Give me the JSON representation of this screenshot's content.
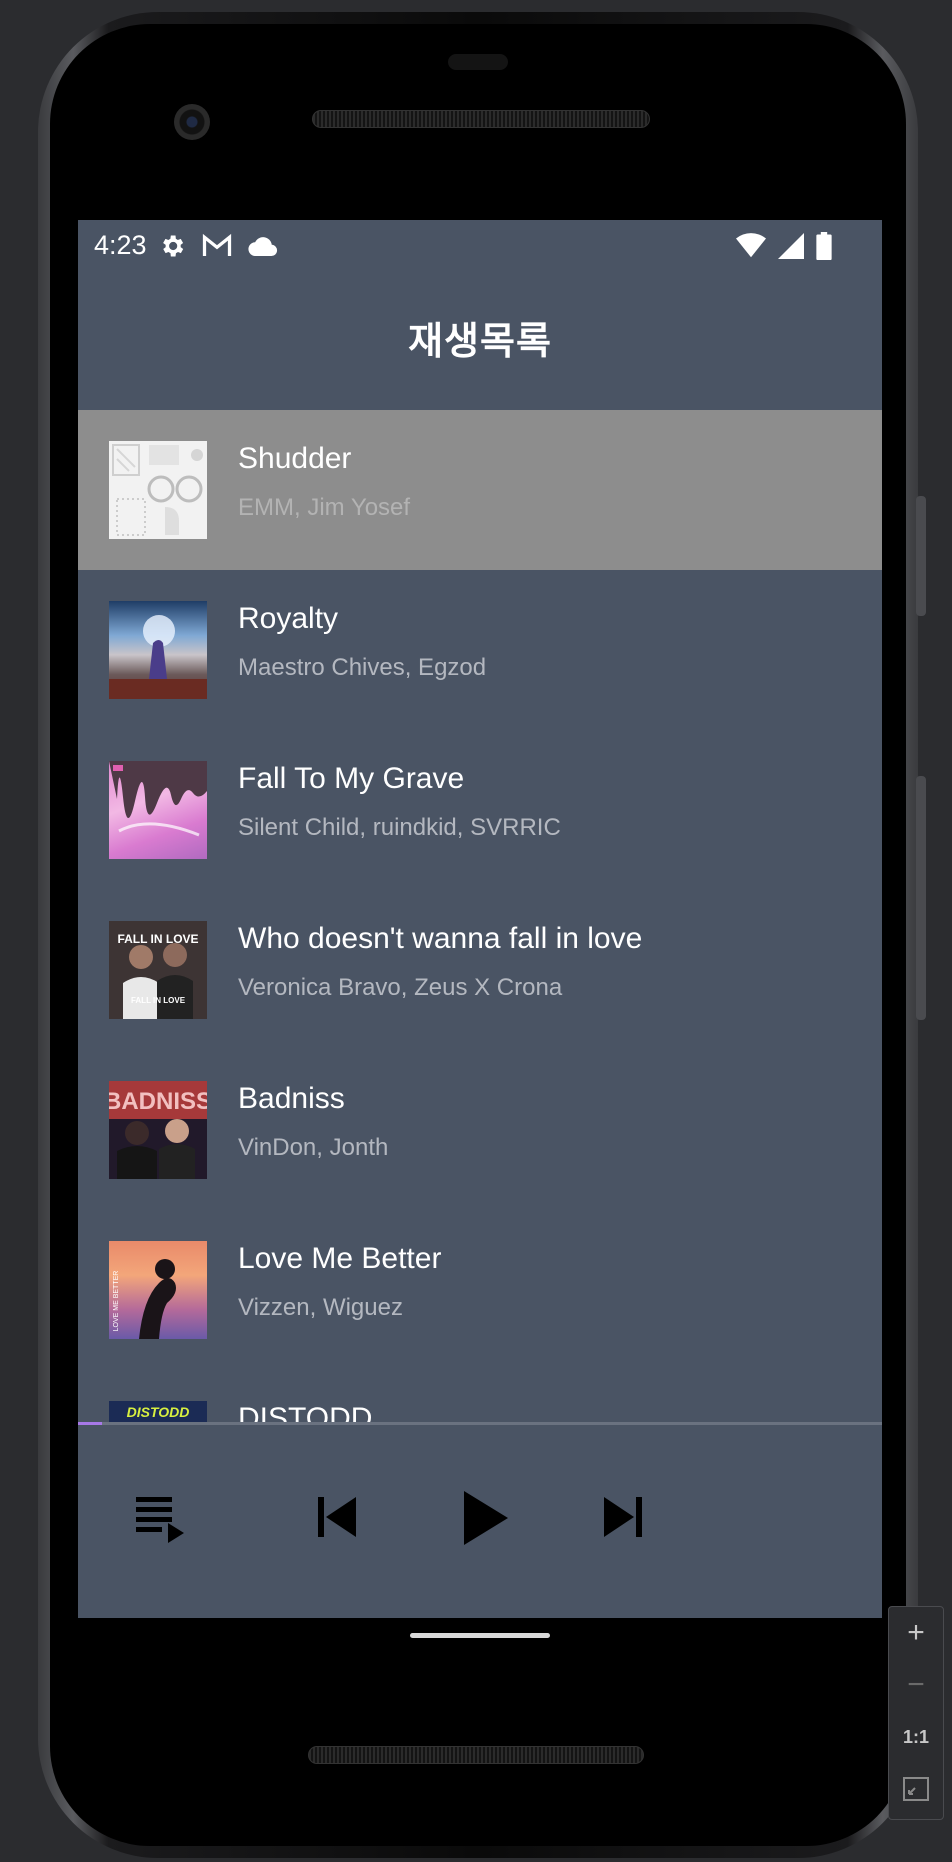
{
  "status_bar": {
    "time": "4:23",
    "left_icons": [
      "gear-icon",
      "gmail-icon",
      "cloud-icon"
    ],
    "right_icons": [
      "wifi-icon",
      "signal-icon",
      "battery-icon"
    ]
  },
  "header": {
    "title": "재생목록"
  },
  "playlist": {
    "items": [
      {
        "title": "Shudder",
        "artist": "EMM, Jim Yosef",
        "selected": true
      },
      {
        "title": "Royalty",
        "artist": "Maestro Chives, Egzod",
        "selected": false
      },
      {
        "title": "Fall To My Grave",
        "artist": "Silent Child, ruindkid, SVRRIC",
        "selected": false
      },
      {
        "title": "Who doesn't wanna fall in love",
        "artist": "Veronica Bravo, Zeus X Crona",
        "selected": false
      },
      {
        "title": "Badniss",
        "artist": "VinDon, Jonth",
        "selected": false
      },
      {
        "title": "Love Me Better",
        "artist": "Vizzen, Wiguez",
        "selected": false
      },
      {
        "title": "DISTODD",
        "artist": "",
        "selected": false
      }
    ],
    "art_text": {
      "fall_in_love": "FALL IN LOVE",
      "badniss": "BADNISS",
      "distodd": "DISTODD",
      "love_me_better": "LOVE ME BETTER"
    }
  },
  "player": {
    "progress_fraction": 0.03,
    "accent_color": "#a879e8",
    "buttons": [
      "queue-icon",
      "skip-previous-icon",
      "play-icon",
      "skip-next-icon"
    ]
  },
  "emulator": {
    "zoom_in": "+",
    "zoom_out": "−",
    "actual_size": "1:1"
  },
  "colors": {
    "background": "#4a5464",
    "selected_row": "#8d8d8d",
    "text_primary": "#ffffff",
    "text_secondary": "#b4b8c0"
  }
}
